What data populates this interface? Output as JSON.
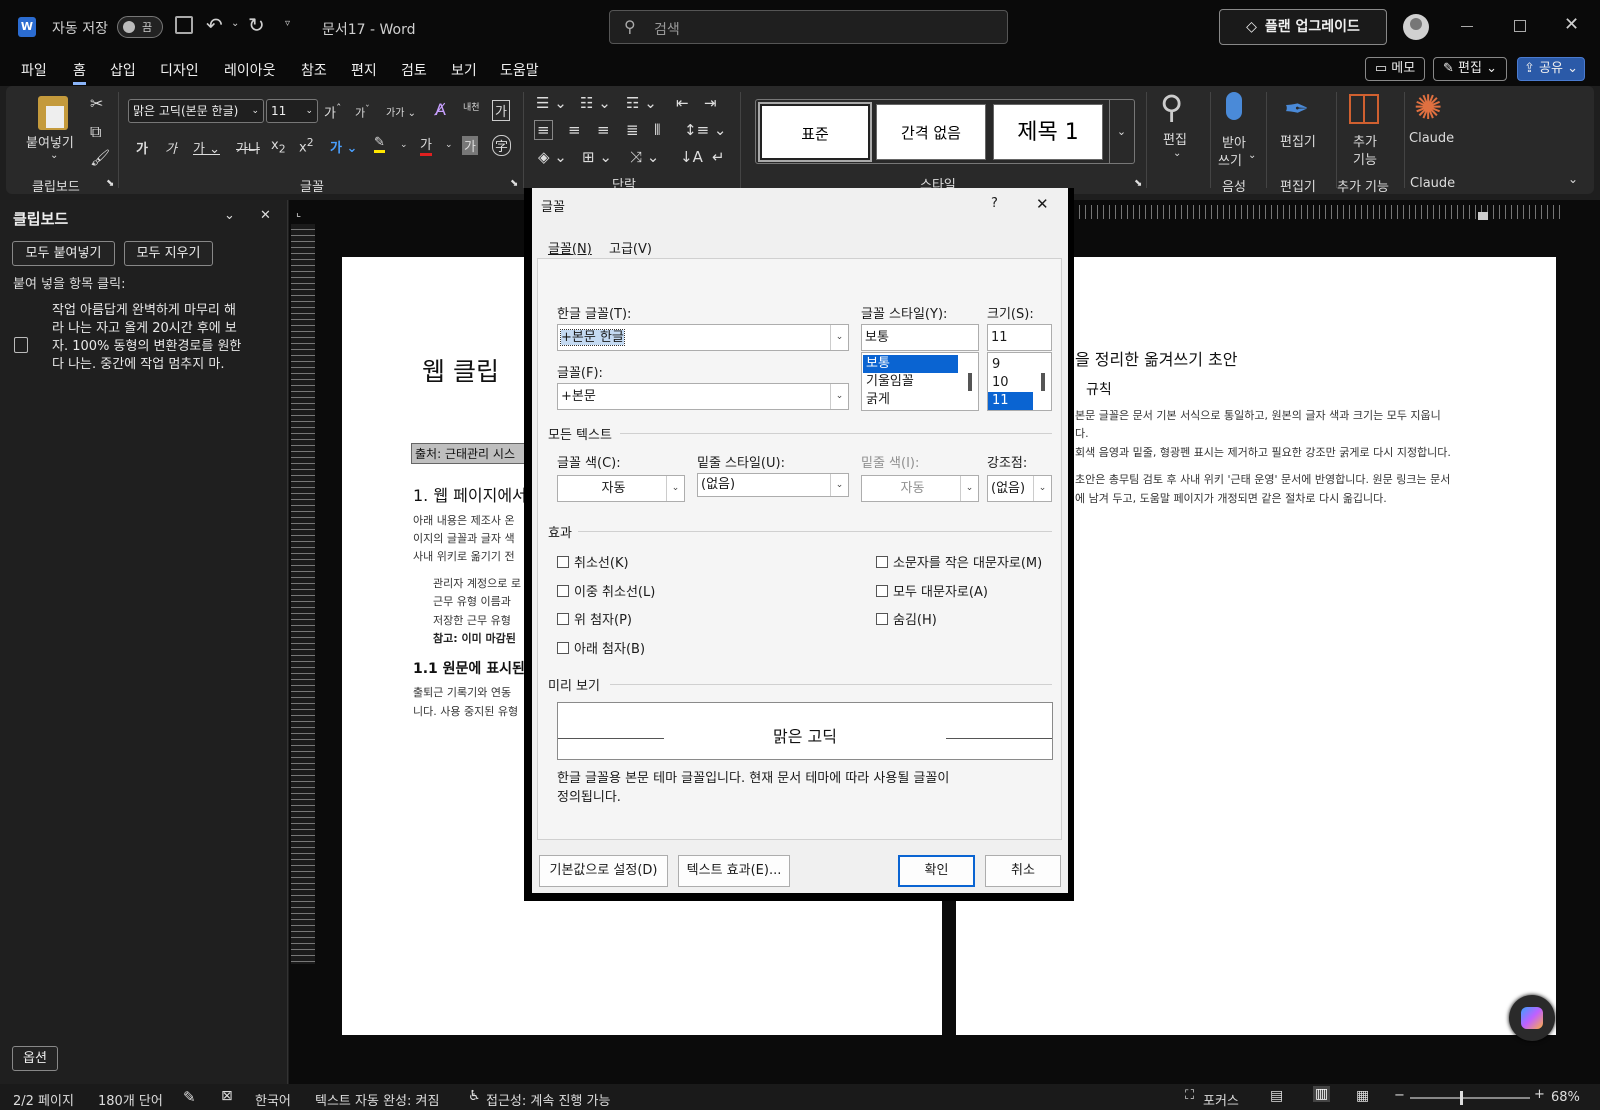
{
  "titlebar": {
    "app_icon": "word-logo-icon",
    "autosave_label": "자동 저장",
    "autosave_state": "끔",
    "doc_title": "문서17  -  Word",
    "search_placeholder": "검색",
    "upgrade_label": "플랜 업그레이드"
  },
  "tabs": [
    "파일",
    "홈",
    "삽입",
    "디자인",
    "레이아웃",
    "참조",
    "편지",
    "검토",
    "보기",
    "도움말"
  ],
  "tab_right": {
    "memo": "메모",
    "edit": "편집",
    "share": "공유"
  },
  "ribbon": {
    "paste_label": "붙여넣기",
    "font_name": "맑은 고딕(본문 한글)",
    "font_size": "11",
    "groups": [
      "클립보드",
      "글꼴",
      "단락",
      "스타일",
      "음성",
      "편집기",
      "추가 기능",
      "Claude"
    ],
    "styles": [
      "표준",
      "간격 없음",
      "제목 1"
    ],
    "edit_label": "편집",
    "dictate_label1": "받아",
    "dictate_label2": "쓰기",
    "editor_label": "편집기",
    "addins_label1": "추가",
    "addins_label2": "기능",
    "claude_label": "Claude"
  },
  "clipboard": {
    "title": "클립보드",
    "paste_all": "모두 붙여넣기",
    "clear_all": "모두 지우기",
    "hint": "붙여 넣을 항목 클릭:",
    "item_text": "작업 아름답게 완벽하게 마무리 해라 나는 자고 올게 20시간 후에 보자. 100% 동형의 변환경로를 원한다 나는. 중간에 작업 멈추지 마.",
    "options": "옵션"
  },
  "doc_left": {
    "title": "웹 클립",
    "source": "출처: 근태관리 시스",
    "h1": "1. 웹 페이지에서",
    "p1": [
      "아래 내용은 제조사 온",
      "이지의 글꼴과 글자 색",
      "사내 위키로 옮기기 전"
    ],
    "list": [
      "관리자 계정으로 로",
      "근무 유형 이름과",
      "저장한 근무 유형"
    ],
    "note": "참고: 이미 마감된",
    "h2": "1.1 원문에 표시된",
    "p2": [
      "출퇴근 기록기와 연동",
      "니다. 사용 중지된 유형"
    ]
  },
  "doc_right": {
    "title": "을 정리한 옮겨쓰기 초안",
    "h": "규칙",
    "lines": [
      "본문 글꼴은 문서 기본 서식으로 통일하고, 원본의 글자 색과 크기는 모두 지웁니",
      "다.",
      "회색 음영과 밑줄, 형광펜 표시는 제거하고 필요한 강조만 굵게로 다시 지정합니다.",
      "초안은 총무팀 검토 후 사내 위키 '근태 운영' 문서에 반영합니다. 원문 링크는 문서",
      "에 남겨 두고, 도움말 페이지가 개정되면 같은 절차로 다시 옮깁니다."
    ]
  },
  "dialog": {
    "title": "글꼴",
    "help": "?",
    "tab_font": "글꼴(N)",
    "tab_advanced": "고급(V)",
    "korean_font_label": "한글 글꼴(T):",
    "korean_font_value": "+본문 한글",
    "font_label": "글꼴(F):",
    "font_value": "+본문",
    "style_label": "글꼴 스타일(Y):",
    "style_value": "보통",
    "style_options": [
      "보통",
      "기울임꼴",
      "굵게"
    ],
    "size_label": "크기(S):",
    "size_value": "11",
    "size_options": [
      "9",
      "10",
      "11"
    ],
    "all_text": "모든 텍스트",
    "color_label": "글꼴 색(C):",
    "color_value": "자동",
    "underline_label": "밑줄 스타일(U):",
    "underline_value": "(없음)",
    "underline_color_label": "밑줄 색(I):",
    "underline_color_value": "자동",
    "emphasis_label": "강조점:",
    "emphasis_value": "(없음)",
    "effects": "효과",
    "effects_left": [
      "취소선(K)",
      "이중 취소선(L)",
      "위 첨자(P)",
      "아래 첨자(B)"
    ],
    "effects_right": [
      "소문자를 작은 대문자로(M)",
      "모두 대문자로(A)",
      "숨김(H)"
    ],
    "preview_label": "미리 보기",
    "preview_text": "맑은 고딕",
    "preview_desc1": "한글 글꼴용 본문 테마 글꼴입니다. 현재 문서 테마에 따라 사용될 글꼴이",
    "preview_desc2": "정의됩니다.",
    "set_default": "기본값으로 설정(D)",
    "text_effects": "텍스트 효과(E)...",
    "ok": "확인",
    "cancel": "취소"
  },
  "status": {
    "page": "2/2 페이지",
    "words": "180개 단어",
    "language": "한국어",
    "autocomplete": "텍스트 자동 완성: 켜짐",
    "accessibility": "접근성: 계속 진행 가능",
    "focus": "포커스",
    "zoom": "68%"
  }
}
